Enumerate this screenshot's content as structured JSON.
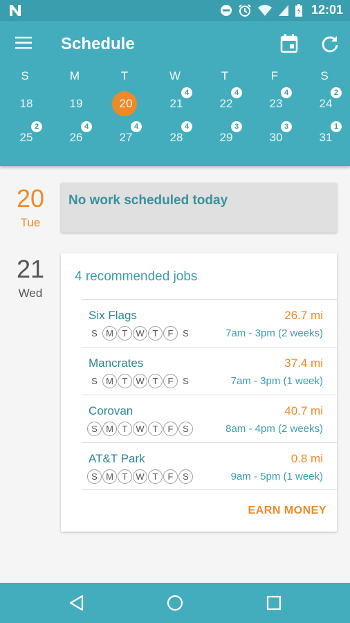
{
  "status_bar": {
    "time": "12:01",
    "icons": [
      "n-logo-icon",
      "dnd-icon",
      "alarm-icon",
      "wifi-icon",
      "signal-icon",
      "battery-icon"
    ]
  },
  "app_bar": {
    "title": "Schedule",
    "icons": [
      "menu-icon",
      "calendar-icon",
      "refresh-icon"
    ]
  },
  "calendar": {
    "days_of_week": [
      "S",
      "M",
      "T",
      "W",
      "T",
      "F",
      "S"
    ],
    "weeks": [
      [
        {
          "day": "18",
          "badge": ""
        },
        {
          "day": "19",
          "badge": ""
        },
        {
          "day": "20",
          "badge": "",
          "selected": true
        },
        {
          "day": "21",
          "badge": "4"
        },
        {
          "day": "22",
          "badge": "4"
        },
        {
          "day": "23",
          "badge": "4"
        },
        {
          "day": "24",
          "badge": "2"
        }
      ],
      [
        {
          "day": "25",
          "badge": "2"
        },
        {
          "day": "26",
          "badge": "4"
        },
        {
          "day": "27",
          "badge": "4"
        },
        {
          "day": "28",
          "badge": "4"
        },
        {
          "day": "29",
          "badge": "3"
        },
        {
          "day": "30",
          "badge": "3"
        },
        {
          "day": "31",
          "badge": "1"
        }
      ]
    ]
  },
  "today": {
    "day_num": "20",
    "day_name": "Tue",
    "message": "No work scheduled today"
  },
  "next_day": {
    "day_num": "21",
    "day_name": "Wed",
    "heading": "4 recommended jobs",
    "jobs": [
      {
        "name": "Six Flags",
        "distance": "26.7 mi",
        "time": "7am - 3pm (2 weeks)",
        "days": [
          [
            "S",
            false
          ],
          [
            "M",
            true
          ],
          [
            "T",
            true
          ],
          [
            "W",
            true
          ],
          [
            "T",
            true
          ],
          [
            "F",
            true
          ],
          [
            "S",
            false
          ]
        ]
      },
      {
        "name": "Mancrates",
        "distance": "37.4 mi",
        "time": "7am - 3pm (1 week)",
        "days": [
          [
            "S",
            false
          ],
          [
            "M",
            true
          ],
          [
            "T",
            true
          ],
          [
            "W",
            true
          ],
          [
            "T",
            true
          ],
          [
            "F",
            true
          ],
          [
            "S",
            false
          ]
        ]
      },
      {
        "name": "Corovan",
        "distance": "40.7 mi",
        "time": "8am - 4pm (2 weeks)",
        "days": [
          [
            "S",
            true
          ],
          [
            "M",
            true
          ],
          [
            "T",
            true
          ],
          [
            "W",
            true
          ],
          [
            "T",
            true
          ],
          [
            "F",
            true
          ],
          [
            "S",
            true
          ]
        ]
      },
      {
        "name": "AT&T Park",
        "distance": "0.8 mi",
        "time": "9am - 5pm (1 week)",
        "days": [
          [
            "S",
            true
          ],
          [
            "M",
            true
          ],
          [
            "T",
            true
          ],
          [
            "W",
            true
          ],
          [
            "T",
            true
          ],
          [
            "F",
            true
          ],
          [
            "S",
            true
          ]
        ]
      }
    ],
    "action_label": "EARN MONEY"
  },
  "colors": {
    "primary": "#44adbd",
    "accent": "#ef8a28"
  },
  "nav_bar": {
    "icons": [
      "back-icon",
      "home-icon",
      "recents-icon"
    ]
  }
}
